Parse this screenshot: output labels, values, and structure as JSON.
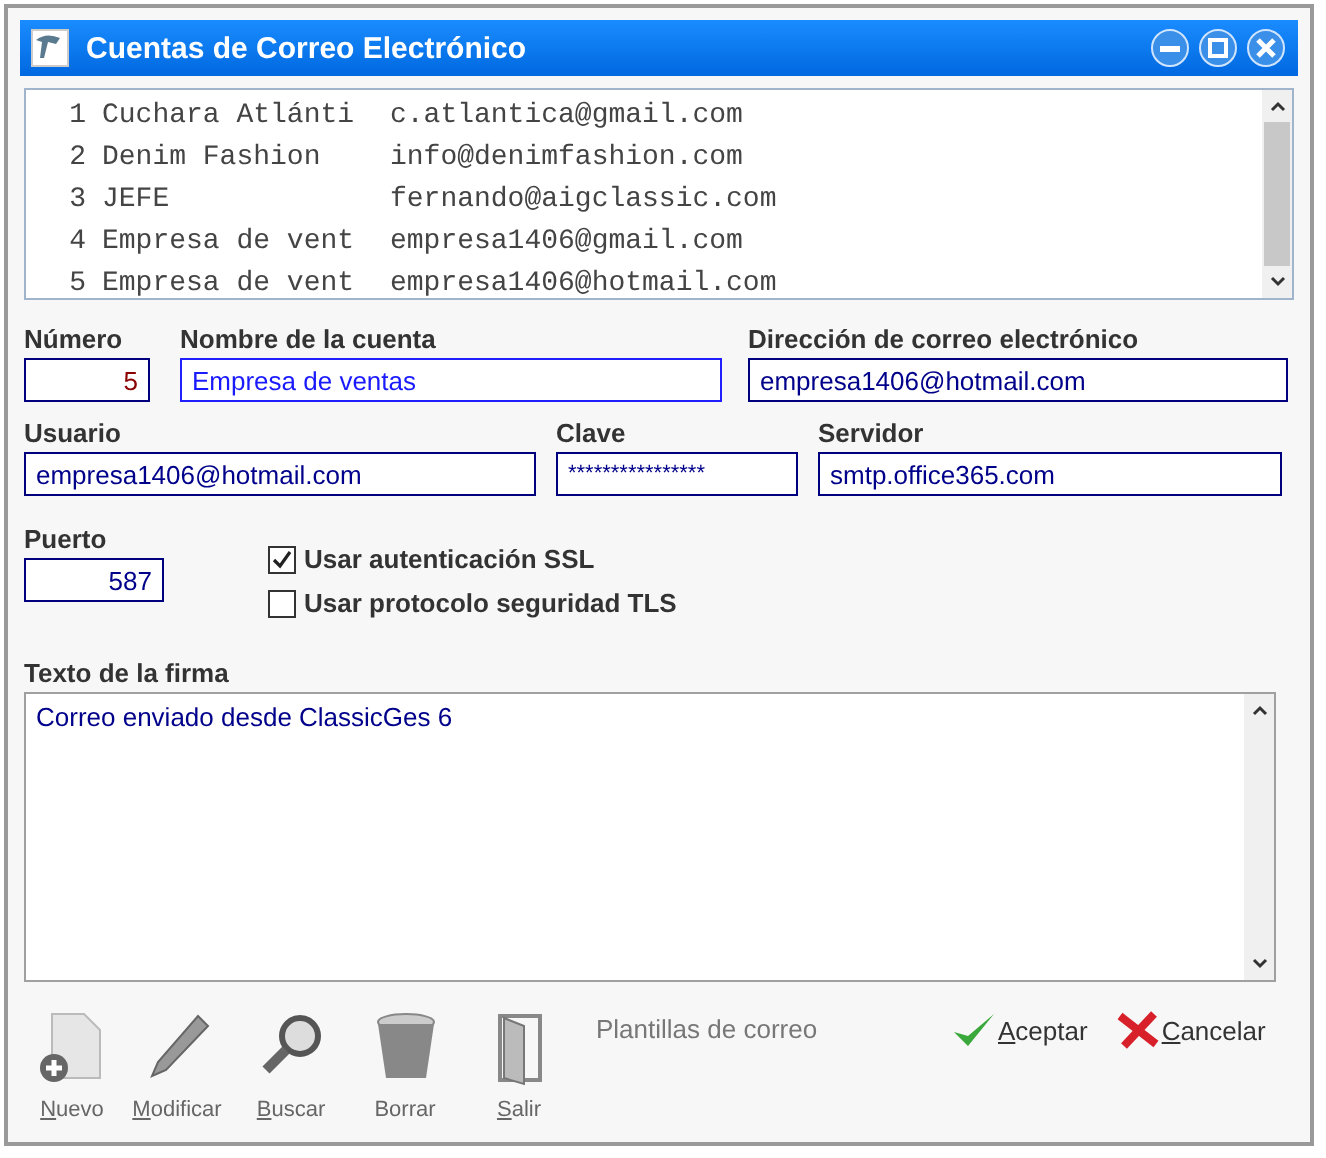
{
  "window": {
    "title": "Cuentas de Correo Electrónico"
  },
  "accounts": [
    {
      "number": "1",
      "name": "Cuchara Atlánti",
      "email": "c.atlantica@gmail.com"
    },
    {
      "number": "2",
      "name": "Denim Fashion",
      "email": "info@denimfashion.com"
    },
    {
      "number": "3",
      "name": "JEFE",
      "email": "fernando@aigclassic.com"
    },
    {
      "number": "4",
      "name": "Empresa de vent",
      "email": "empresa1406@gmail.com"
    },
    {
      "number": "5",
      "name": "Empresa de vent",
      "email": "empresa1406@hotmail.com"
    }
  ],
  "field_rows": [
    [
      {
        "label": "Número",
        "value": "5",
        "kind": "number",
        "focused": false
      },
      {
        "label": "Nombre de la cuenta",
        "value": "Empresa de ventas",
        "kind": "text",
        "focused": true
      },
      {
        "label": "Dirección de correo electrónico",
        "value": "empresa1406@hotmail.com",
        "kind": "text",
        "focused": false
      }
    ],
    [
      {
        "label": "Usuario",
        "value": "empresa1406@hotmail.com",
        "kind": "text",
        "focused": false
      },
      {
        "label": "Clave",
        "value": "****************",
        "kind": "password",
        "focused": false
      },
      {
        "label": "Servidor",
        "value": "smtp.office365.com",
        "kind": "text",
        "focused": false
      }
    ]
  ],
  "port": {
    "label": "Puerto",
    "value": "587"
  },
  "options": [
    {
      "label": "Usar autenticación SSL",
      "checked": true
    },
    {
      "label": "Usar protocolo seguridad TLS",
      "checked": false
    }
  ],
  "signature": {
    "label": "Texto de la firma",
    "value": "Correo enviado desde ClassicGes 6"
  },
  "toolbar": [
    {
      "label": "Nuevo",
      "kind": "new",
      "underline_first": true
    },
    {
      "label": "Modificar",
      "kind": "edit",
      "underline_first": true
    },
    {
      "label": "Buscar",
      "kind": "search",
      "underline_first": true
    },
    {
      "label": "Borrar",
      "kind": "delete",
      "underline_first": false
    },
    {
      "label": "Salir",
      "kind": "exit",
      "underline_first": true
    }
  ],
  "templates_link": "Plantillas de correo",
  "buttons": [
    {
      "label": "Aceptar",
      "kind": "accept"
    },
    {
      "label": "Cancelar",
      "kind": "cancel"
    }
  ]
}
